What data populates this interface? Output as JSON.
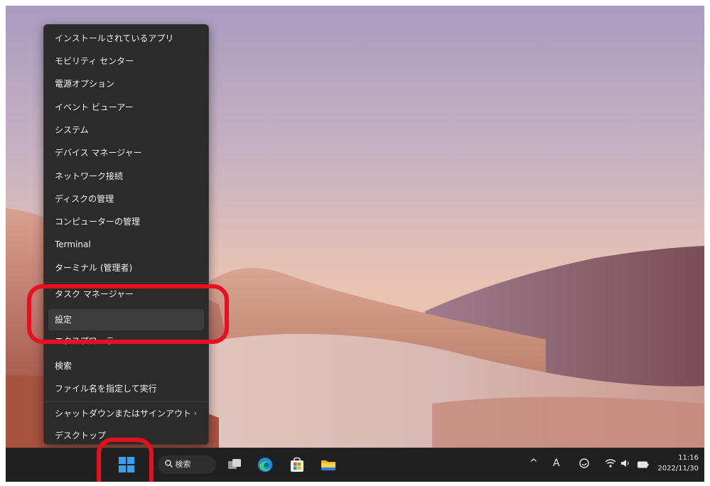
{
  "context_menu": {
    "items": [
      {
        "label": "インストールされているアプリ"
      },
      {
        "label": "モビリティ センター"
      },
      {
        "label": "電源オプション"
      },
      {
        "label": "イベント ビューアー"
      },
      {
        "label": "システム"
      },
      {
        "label": "デバイス マネージャー"
      },
      {
        "label": "ネットワーク接続"
      },
      {
        "label": "ディスクの管理"
      },
      {
        "label": "コンピューターの管理"
      },
      {
        "label": "Terminal"
      },
      {
        "label": "ターミナル (管理者)"
      },
      {
        "label": "タスク マネージャー"
      },
      {
        "label": "設定"
      },
      {
        "label": "エクスプローラー"
      },
      {
        "label": "検索"
      },
      {
        "label": "ファイル名を指定して実行"
      },
      {
        "label": "シャットダウンまたはサインアウト"
      },
      {
        "label": "デスクトップ"
      }
    ],
    "submenu_chevron": "›"
  },
  "taskbar": {
    "search_label": "検索",
    "search_icon": "search-icon",
    "tray": {
      "chevron": "^",
      "ime": "A"
    },
    "clock": {
      "time": "11:16",
      "date": "2022/11/30"
    }
  },
  "colors": {
    "menu_bg": "#2b2b2b",
    "highlight_ring": "#e8101e",
    "taskbar_bg": "#202020",
    "windows_blue": "#3aa0f0"
  }
}
